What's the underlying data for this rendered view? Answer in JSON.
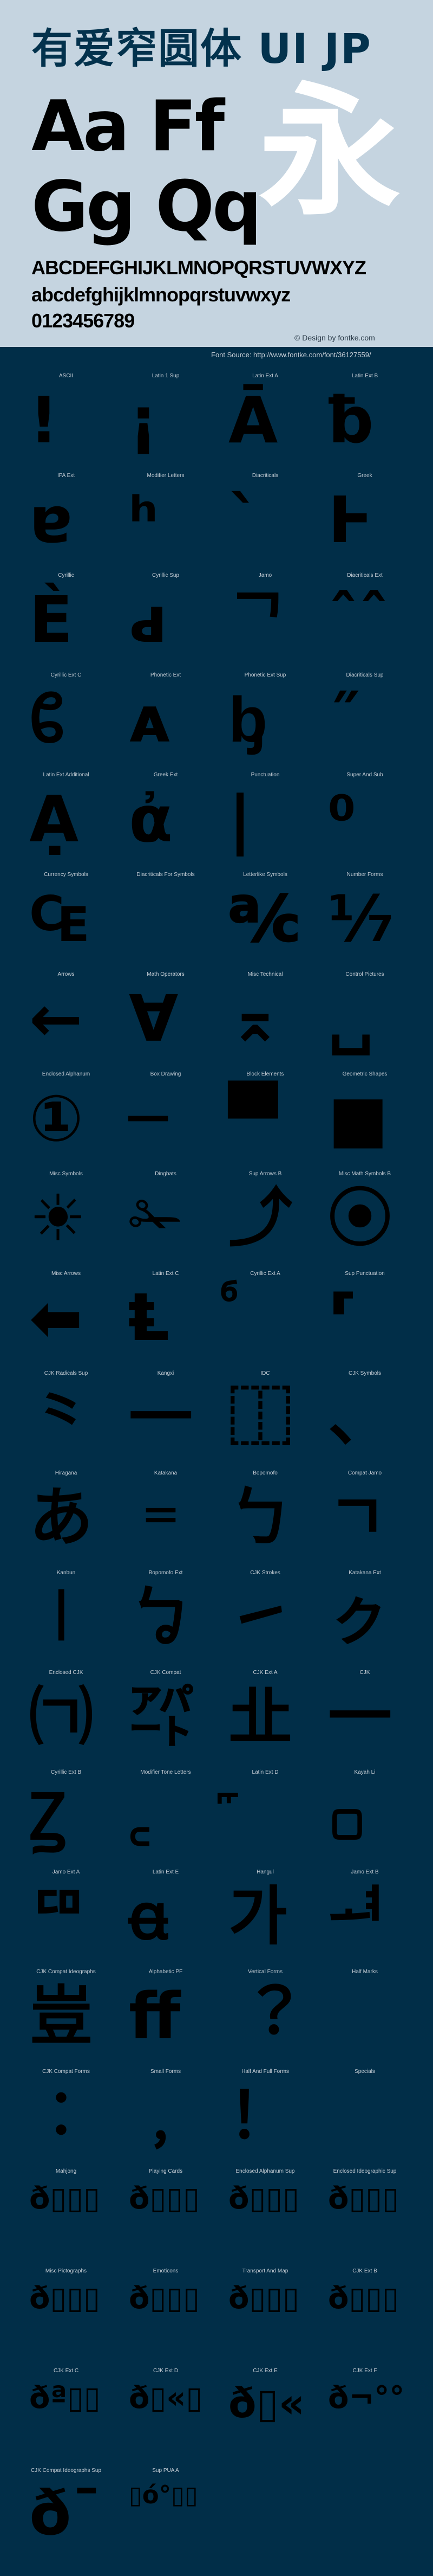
{
  "header": {
    "title": "有爱窄圆体 UI JP",
    "sample_row1": "Aa Ff",
    "sample_row2": "Gg Qq",
    "sample_char": "永",
    "uppercase": "ABCDEFGHIJKLMNOPQRSTUVWXYZ",
    "lowercase": "abcdefghijklmnopqrstuvwxyz",
    "digits": "0123456789",
    "credit": "© Design by fontke.com",
    "font_source": "Font Source: http://www.fontke.com/font/36127559/"
  },
  "colors": {
    "header_bg": "#c5d4e0",
    "page_bg": "#012e48",
    "title": "#03324d",
    "sample_char": "#ffffff"
  },
  "blocks": [
    {
      "label": "ASCII",
      "glyph": "!"
    },
    {
      "label": "Latin 1 Sup",
      "glyph": "¡"
    },
    {
      "label": "Latin Ext A",
      "glyph": "Ā"
    },
    {
      "label": "Latin Ext B",
      "glyph": "ƀ"
    },
    {
      "label": "IPA Ext",
      "glyph": "ɐ"
    },
    {
      "label": "Modifier Letters",
      "glyph": "ʰ"
    },
    {
      "label": "Diacriticals",
      "glyph": "ˋ"
    },
    {
      "label": "Greek",
      "glyph": "Ͱ"
    },
    {
      "label": "Cyrillic",
      "glyph": "Ѐ"
    },
    {
      "label": "Cyrillic Sup",
      "glyph": "ԁ"
    },
    {
      "label": "Jamo",
      "glyph": "ᄀ"
    },
    {
      "label": "Diacriticals Ext",
      "glyph": "ˆˆ"
    },
    {
      "label": "Cyrillic Ext C",
      "glyph": "ᲀ"
    },
    {
      "label": "Phonetic Ext",
      "glyph": "ᴀ"
    },
    {
      "label": "Phonetic Ext Sup",
      "glyph": "ᶀ"
    },
    {
      "label": "Diacriticals Sup",
      "glyph": "˝"
    },
    {
      "label": "Latin Ext Additional",
      "glyph": "Ạ"
    },
    {
      "label": "Greek Ext",
      "glyph": "ἀ"
    },
    {
      "label": "Punctuation",
      "glyph": "|"
    },
    {
      "label": "Super And Sub",
      "glyph": "⁰"
    },
    {
      "label": "Currency Symbols",
      "glyph": "₠"
    },
    {
      "label": "Diacriticals For Symbols",
      "glyph": ""
    },
    {
      "label": "Letterlike Symbols",
      "glyph": "℀"
    },
    {
      "label": "Number Forms",
      "glyph": "⅐"
    },
    {
      "label": "Arrows",
      "glyph": "←"
    },
    {
      "label": "Math Operators",
      "glyph": "∀"
    },
    {
      "label": "Misc Technical",
      "glyph": "⌅"
    },
    {
      "label": "Control Pictures",
      "glyph": "␣"
    },
    {
      "label": "Enclosed Alphanum",
      "glyph": "①"
    },
    {
      "label": "Box Drawing",
      "glyph": "─"
    },
    {
      "label": "Block Elements",
      "glyph": "▀"
    },
    {
      "label": "Geometric Shapes",
      "glyph": "■"
    },
    {
      "label": "Misc Symbols",
      "glyph": "☀"
    },
    {
      "label": "Dingbats",
      "glyph": "✁"
    },
    {
      "label": "Sup Arrows B",
      "glyph": "⤴"
    },
    {
      "label": "Misc Math Symbols B",
      "glyph": "⦿"
    },
    {
      "label": "Misc Arrows",
      "glyph": "⬅"
    },
    {
      "label": "Latin Ext C",
      "glyph": "Ⱡ"
    },
    {
      "label": "Cyrillic Ext A",
      "glyph": "ⷠ"
    },
    {
      "label": "Sup Punctuation",
      "glyph": "⸢"
    },
    {
      "label": "CJK Radicals Sup",
      "glyph": "⺀"
    },
    {
      "label": "Kangxi",
      "glyph": "⼀"
    },
    {
      "label": "IDC",
      "glyph": "⿰"
    },
    {
      "label": "CJK Symbols",
      "glyph": "、"
    },
    {
      "label": "Hiragana",
      "glyph": "あ"
    },
    {
      "label": "Katakana",
      "glyph": "゠"
    },
    {
      "label": "Bopomofo",
      "glyph": "ㄅ"
    },
    {
      "label": "Compat Jamo",
      "glyph": "ㄱ"
    },
    {
      "label": "Kanbun",
      "glyph": "㆐"
    },
    {
      "label": "Bopomofo Ext",
      "glyph": "ㆠ"
    },
    {
      "label": "CJK Strokes",
      "glyph": "㇀"
    },
    {
      "label": "Katakana Ext",
      "glyph": "ㇰ"
    },
    {
      "label": "Enclosed CJK",
      "glyph": "㈀"
    },
    {
      "label": "CJK Compat",
      "glyph": "㌀"
    },
    {
      "label": "CJK Ext A",
      "glyph": "㐀"
    },
    {
      "label": "CJK",
      "glyph": "一"
    },
    {
      "label": "Cyrillic Ext B",
      "glyph": "Ꙁ"
    },
    {
      "label": "Modifier Tone Letters",
      "glyph": "꜀"
    },
    {
      "label": "Latin Ext D",
      "glyph": "꜠"
    },
    {
      "label": "Kayah Li",
      "glyph": "꤀"
    },
    {
      "label": "Jamo Ext A",
      "glyph": "ꥠ"
    },
    {
      "label": "Latin Ext E",
      "glyph": "ꬰ"
    },
    {
      "label": "Hangul",
      "glyph": "가"
    },
    {
      "label": "Jamo Ext B",
      "glyph": "ힰ"
    },
    {
      "label": "CJK Compat Ideographs",
      "glyph": "豈"
    },
    {
      "label": "Alphabetic PF",
      "glyph": "ﬀ"
    },
    {
      "label": "Vertical Forms",
      "glyph": "︖"
    },
    {
      "label": "Half Marks",
      "glyph": ""
    },
    {
      "label": "CJK Compat Forms",
      "glyph": "︰"
    },
    {
      "label": "Small Forms",
      "glyph": "﹐"
    },
    {
      "label": "Half And Full Forms",
      "glyph": "！"
    },
    {
      "label": "Specials",
      "glyph": "￼"
    },
    {
      "label": "Mahjong",
      "glyph": "ð▯▯▯"
    },
    {
      "label": "Playing Cards",
      "glyph": "ð▯▯▯"
    },
    {
      "label": "Enclosed Alphanum Sup",
      "glyph": "ð▯▯▯"
    },
    {
      "label": "Enclosed Ideographic Sup",
      "glyph": "ð▯▯▯"
    },
    {
      "label": "Misc Pictographs",
      "glyph": "ð▯▯▯"
    },
    {
      "label": "Emoticons",
      "glyph": "ð▯▯▯"
    },
    {
      "label": "Transport And Map",
      "glyph": "ð▯▯▯"
    },
    {
      "label": "CJK Ext B",
      "glyph": "ð▯▯▯"
    },
    {
      "label": "CJK Ext C",
      "glyph": "ðª▯▯"
    },
    {
      "label": "CJK Ext D",
      "glyph": "ð▯«▯"
    },
    {
      "label": "CJK Ext E",
      "glyph": "ð▯«"
    },
    {
      "label": "CJK Ext F",
      "glyph": "ð¬°°"
    },
    {
      "label": "CJK Compat Ideographs Sup",
      "glyph": "ð¯"
    },
    {
      "label": "Sup PUA A",
      "glyph": "▯ó°▯▯"
    }
  ]
}
